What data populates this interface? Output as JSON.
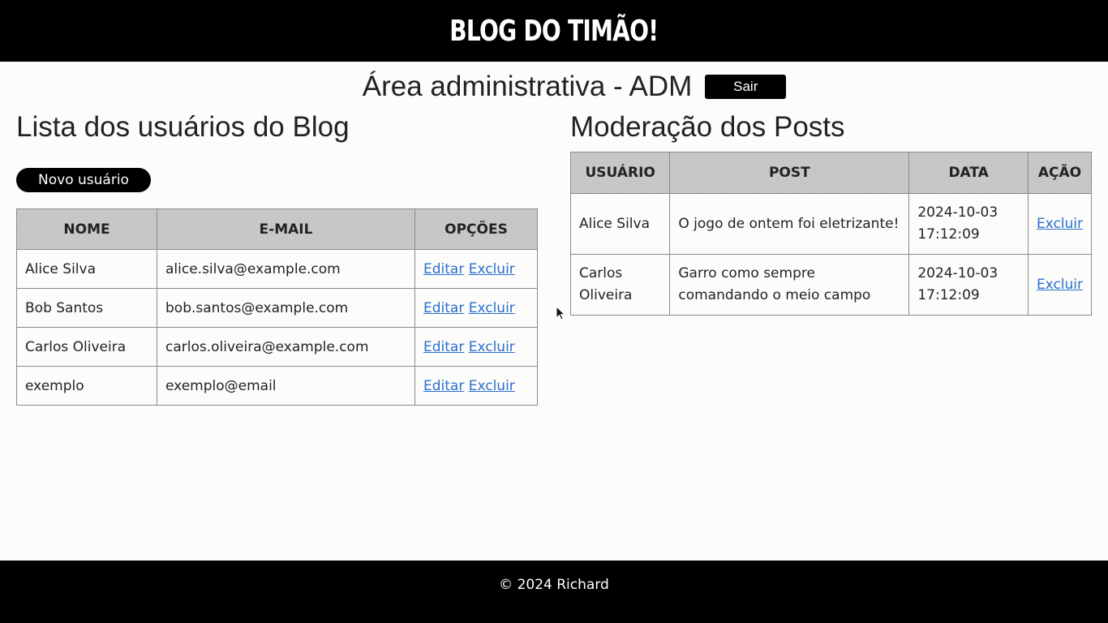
{
  "header": {
    "logo": "BLOG DO TIMÃO!"
  },
  "admin": {
    "title": "Área administrativa - ADM",
    "logout_label": "Sair"
  },
  "users_section": {
    "title": "Lista dos usuários do Blog",
    "new_user_label": "Novo usuário",
    "columns": [
      "NOME",
      "E-MAIL",
      "OPÇÕES"
    ],
    "rows": [
      {
        "nome": "Alice Silva",
        "email": "alice.silva@example.com",
        "edit": "Editar",
        "delete": "Excluir"
      },
      {
        "nome": "Bob Santos",
        "email": "bob.santos@example.com",
        "edit": "Editar",
        "delete": "Excluir"
      },
      {
        "nome": "Carlos Oliveira",
        "email": "carlos.oliveira@example.com",
        "edit": "Editar",
        "delete": "Excluir"
      },
      {
        "nome": "exemplo",
        "email": "exemplo@email",
        "edit": "Editar",
        "delete": "Excluir"
      }
    ]
  },
  "posts_section": {
    "title": "Moderação dos Posts",
    "columns": [
      "USUÁRIO",
      "POST",
      "DATA",
      "AÇÃO"
    ],
    "rows": [
      {
        "usuario": "Alice Silva",
        "post": "O jogo de ontem foi eletrizante!",
        "data": "2024-10-03 17:12:09",
        "acao": "Excluir"
      },
      {
        "usuario": "Carlos Oliveira",
        "post": "Garro como sempre comandando o meio campo",
        "data": "2024-10-03 17:12:09",
        "acao": "Excluir"
      }
    ]
  },
  "footer": {
    "text": "© 2024 Richard"
  },
  "colors": {
    "header_bg": "#000000",
    "link": "#2a6fcf",
    "table_header_bg": "#c9c9c9",
    "page_bg": "#fcfcfa"
  },
  "icons": {
    "cursor": "mouse-pointer-icon"
  }
}
